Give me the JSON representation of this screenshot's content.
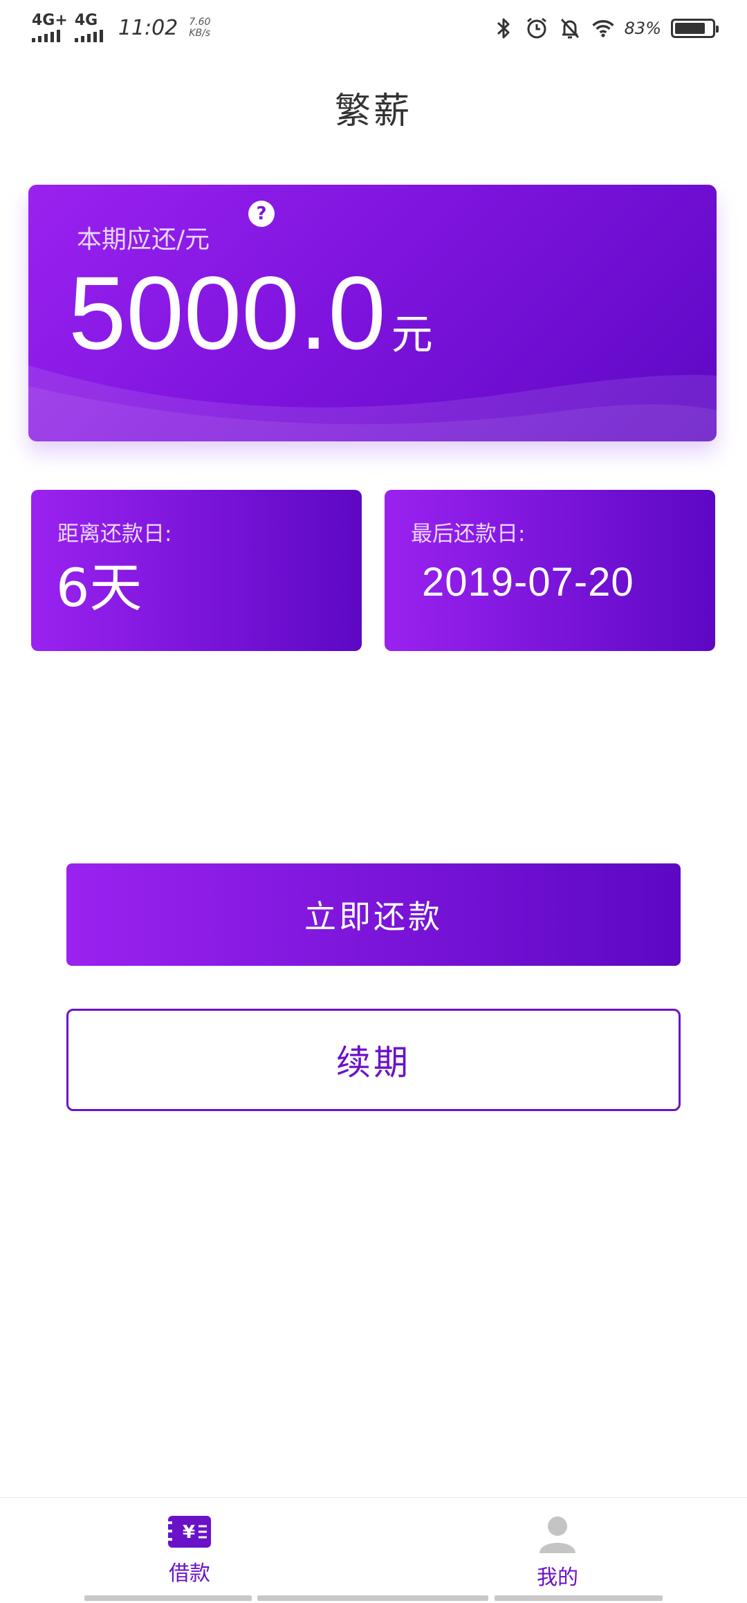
{
  "status_bar": {
    "signal1_label": "4G+",
    "signal2_label": "4G",
    "time": "11:02",
    "speed_value": "7.60",
    "speed_unit": "KB/s",
    "battery_percent": "83%",
    "battery_level": 0.83,
    "icons": [
      "bluetooth-icon",
      "alarm-icon",
      "mute-icon",
      "wifi-icon",
      "battery-icon"
    ]
  },
  "header": {
    "title": "繁薪"
  },
  "due_card": {
    "label": "本期应还/元",
    "help_symbol": "?",
    "amount": "5000.0",
    "unit": "元"
  },
  "info_cards": {
    "days_label": "距离还款日:",
    "days_value": "6天",
    "date_label": "最后还款日:",
    "date_value": "2019-07-20"
  },
  "actions": {
    "repay_label": "立即还款",
    "renew_label": "续期"
  },
  "bottom_nav": {
    "loan_label": "借款",
    "mine_label": "我的",
    "loan_icon_text": "¥",
    "active_color": "#6a12c8"
  },
  "colors": {
    "gradient_start": "#9a22f0",
    "gradient_end": "#5d08c4",
    "accent": "#6a12c8"
  }
}
